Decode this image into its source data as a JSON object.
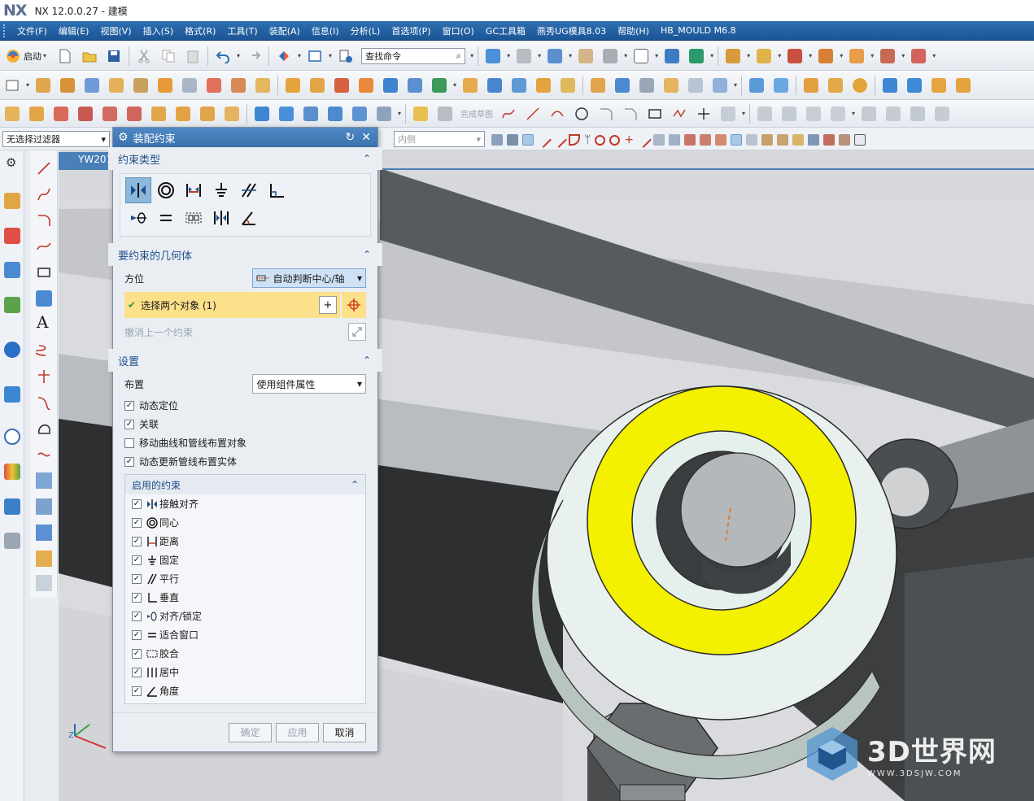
{
  "app": {
    "logo": "NX",
    "title": "NX 12.0.0.27 - 建模"
  },
  "menu": [
    "文件(F)",
    "编辑(E)",
    "视图(V)",
    "插入(S)",
    "格式(R)",
    "工具(T)",
    "装配(A)",
    "信息(I)",
    "分析(L)",
    "首选项(P)",
    "窗口(O)",
    "GC工具箱",
    "燕秀UG模具8.03",
    "帮助(H)",
    "HB_MOULD M6.8"
  ],
  "toolbar": {
    "start_label": "启动",
    "search_placeholder": "查找命令",
    "complete_sketch": "完成草图",
    "filter_value": "无选择过滤器",
    "inner_value": "内侧"
  },
  "viewport": {
    "tab_label": "YW201"
  },
  "dialog": {
    "title": "装配约束",
    "sections": {
      "constraint_type": "约束类型",
      "geometry": "要约束的几何体",
      "settings": "设置"
    },
    "orientation_label": "方位",
    "orientation_value": "自动判断中心/轴",
    "select_label": "选择两个对象 (1)",
    "undo_label": "撤消上一个约束",
    "layout_label": "布置",
    "layout_value": "使用组件属性",
    "options": [
      {
        "label": "动态定位",
        "checked": true
      },
      {
        "label": "关联",
        "checked": true
      },
      {
        "label": "移动曲线和管线布置对象",
        "checked": false
      },
      {
        "label": "动态更新管线布置实体",
        "checked": true
      }
    ],
    "enabled_title": "启用的约束",
    "enabled": [
      {
        "label": "接触对齐",
        "checked": true
      },
      {
        "label": "同心",
        "checked": true
      },
      {
        "label": "距离",
        "checked": true
      },
      {
        "label": "固定",
        "checked": true
      },
      {
        "label": "平行",
        "checked": true
      },
      {
        "label": "垂直",
        "checked": true
      },
      {
        "label": "对齐/锁定",
        "checked": true
      },
      {
        "label": "适合窗口",
        "checked": true
      },
      {
        "label": "胶合",
        "checked": true
      },
      {
        "label": "居中",
        "checked": true
      },
      {
        "label": "角度",
        "checked": true
      }
    ],
    "buttons": {
      "ok": "确定",
      "apply": "应用",
      "cancel": "取消"
    }
  },
  "watermark": {
    "big": "3D世界网",
    "small": "WWW.3DSJW.COM"
  },
  "colors": {
    "accent": "#2f6fb0",
    "ring_yellow": "#f3f000",
    "selection_yellow": "#fde08a"
  }
}
